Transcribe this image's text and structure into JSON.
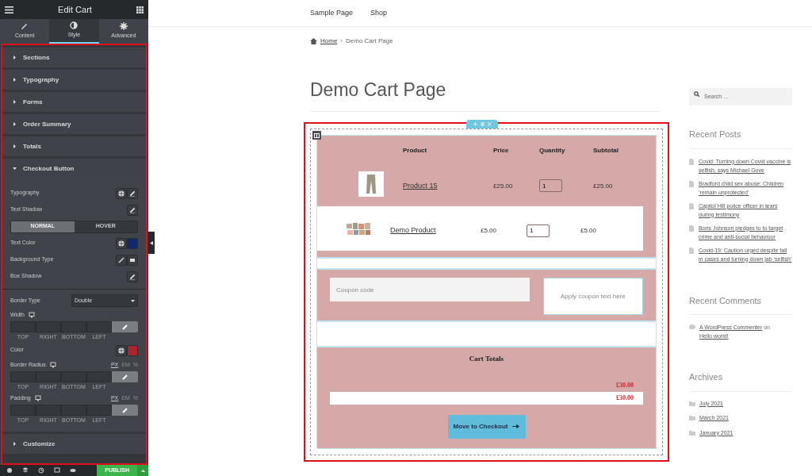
{
  "editor": {
    "title": "Edit Cart",
    "tabs": [
      {
        "label": "Content",
        "selected": false
      },
      {
        "label": "Style",
        "selected": true
      },
      {
        "label": "Advanced",
        "selected": false
      }
    ],
    "sections": [
      {
        "label": "Sections",
        "expanded": false
      },
      {
        "label": "Typography",
        "expanded": false
      },
      {
        "label": "Forms",
        "expanded": false
      },
      {
        "label": "Order Summary",
        "expanded": false
      },
      {
        "label": "Totals",
        "expanded": false
      },
      {
        "label": "Checkout Button",
        "expanded": true
      }
    ],
    "controls": [
      {
        "kind": "typography",
        "label": "Typography"
      },
      {
        "kind": "edit",
        "label": "Text Shadow"
      },
      {
        "kind": "toggle",
        "options": [
          {
            "label": "NORMAL",
            "selected": true
          },
          {
            "label": "HOVER",
            "selected": false
          }
        ]
      },
      {
        "kind": "color",
        "label": "Text Color",
        "color": "#112a6b"
      },
      {
        "kind": "background",
        "label": "Background Type"
      },
      {
        "kind": "edit",
        "label": "Box Shadow"
      },
      {
        "kind": "select",
        "label": "Border Type",
        "value": "Double"
      },
      {
        "kind": "dimensions",
        "label": "Width",
        "sides": [
          "TOP",
          "RIGHT",
          "BOTTOM",
          "LEFT"
        ]
      },
      {
        "kind": "color",
        "label": "Color",
        "color": "#a8262c"
      },
      {
        "kind": "dimensions",
        "label": "Border Radius",
        "units": [
          {
            "label": "PX",
            "selected": true
          },
          {
            "label": "EM",
            "selected": false
          },
          {
            "label": "%",
            "selected": false
          }
        ],
        "sides": [
          "TOP",
          "RIGHT",
          "BOTTOM",
          "LEFT"
        ]
      },
      {
        "kind": "dimensions",
        "label": "Padding",
        "units": [
          {
            "label": "PX",
            "selected": true
          },
          {
            "label": "EM",
            "selected": false
          },
          {
            "label": "%",
            "selected": false
          }
        ],
        "sides": [
          "TOP",
          "RIGHT",
          "BOTTOM",
          "LEFT"
        ]
      }
    ],
    "footer_section": {
      "label": "Customize",
      "expanded": false
    },
    "publish": "PUBLISH"
  },
  "nav": [
    "Sample Page",
    "Shop"
  ],
  "breadcrumb": {
    "home": "Home",
    "separator": "›",
    "current": "Demo Cart Page"
  },
  "page_title": "Demo Cart Page",
  "cart": {
    "columns": [
      "Product",
      "Price",
      "Quantity",
      "Subtotal"
    ],
    "rows": [
      {
        "name": "Product 15",
        "price": "£25.00",
        "quantity": "1",
        "subtotal": "£25.00"
      },
      {
        "name": "Demo Product",
        "price": "£5.00",
        "quantity": "1",
        "subtotal": "£5.00"
      }
    ],
    "coupon_placeholder": "Coupon code",
    "apply_button": "Apply coupon text here",
    "totals_title": "Cart Totals",
    "totals": [
      "£30.00",
      "£30.00"
    ],
    "checkout_button": "Move to Checkout"
  },
  "sidebar": {
    "search_placeholder": "Search …",
    "recent_posts": {
      "title": "Recent Posts",
      "items": [
        "Covid: Turning down Covid vaccine is selfish, says Michael Gove",
        "Bradford child sex abuse: Children ‘remain unprotected’",
        "Capitol Hill police officer in tears during testimony",
        "Boris Johnson pledges to to target crime and anti-social behaviour",
        "Covid-19: Caution urged despite fall in cases and turning down jab ‘selfish’"
      ]
    },
    "recent_comments": {
      "title": "Recent Comments",
      "items": [
        {
          "author": "A WordPress Commenter",
          "connector": "on",
          "post": "Hello world!"
        }
      ]
    },
    "archives": {
      "title": "Archives",
      "items": [
        "July 2021",
        "March 2021",
        "January 2021"
      ]
    }
  }
}
